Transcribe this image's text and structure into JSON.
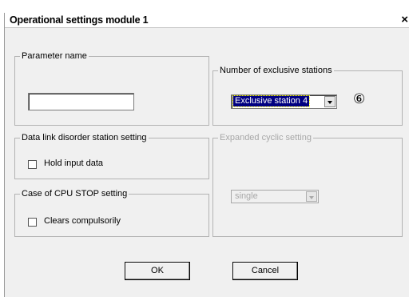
{
  "window": {
    "title": "Operational settings  module 1",
    "close_glyph": "×"
  },
  "parameter_name": {
    "legend": "Parameter name",
    "value": ""
  },
  "exclusive_stations": {
    "legend": "Number of exclusive stations",
    "selected": "Exclusive station 4",
    "marker": "⑥"
  },
  "data_link": {
    "legend": "Data link disorder station setting",
    "checkbox_label": "Hold input data",
    "checked": false
  },
  "cpu_stop": {
    "legend": "Case of CPU STOP setting",
    "checkbox_label": "Clears compulsorily",
    "checked": false
  },
  "expanded_cyclic": {
    "legend": "Expanded cyclic setting",
    "selected": "single",
    "disabled": true
  },
  "buttons": {
    "ok": "OK",
    "cancel": "Cancel"
  }
}
